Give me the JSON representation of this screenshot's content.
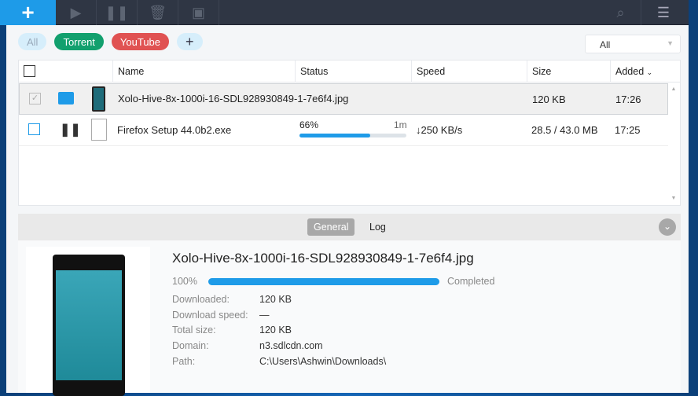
{
  "toolbar": {
    "buttons": [
      "add",
      "play",
      "pause",
      "delete",
      "save"
    ],
    "right": [
      "search",
      "menu"
    ]
  },
  "filters": {
    "all": "All",
    "torrent": "Torrent",
    "youtube": "YouTube",
    "add": "+",
    "dropdown": "All"
  },
  "columns": {
    "name": "Name",
    "status": "Status",
    "speed": "Speed",
    "size": "Size",
    "added": "Added"
  },
  "rows": [
    {
      "name": "Xolo-Hive-8x-1000i-16-SDL928930849-1-7e6f4.jpg",
      "size": "120 KB",
      "added": "17:26"
    },
    {
      "name": "Firefox Setup 44.0b2.exe",
      "percent": "66%",
      "progress": 66,
      "eta": "1m",
      "speed": "↓250 KB/s",
      "size": "28.5 / 43.0 MB",
      "added": "17:25"
    }
  ],
  "details": {
    "tabs": {
      "general": "General",
      "log": "Log"
    },
    "title": "Xolo-Hive-8x-1000i-16-SDL928930849-1-7e6f4.jpg",
    "percent": "100%",
    "progress": 100,
    "status": "Completed",
    "labels": {
      "downloaded": "Downloaded:",
      "speed": "Download speed:",
      "total": "Total size:",
      "domain": "Domain:",
      "path": "Path:"
    },
    "values": {
      "downloaded": "120 KB",
      "speed": "—",
      "total": "120 KB",
      "domain": "n3.sdlcdn.com",
      "path": "C:\\Users\\Ashwin\\Downloads\\"
    }
  },
  "colors": {
    "accent": "#1e9be8",
    "torrent": "#12a06e",
    "youtube": "#e05252"
  }
}
